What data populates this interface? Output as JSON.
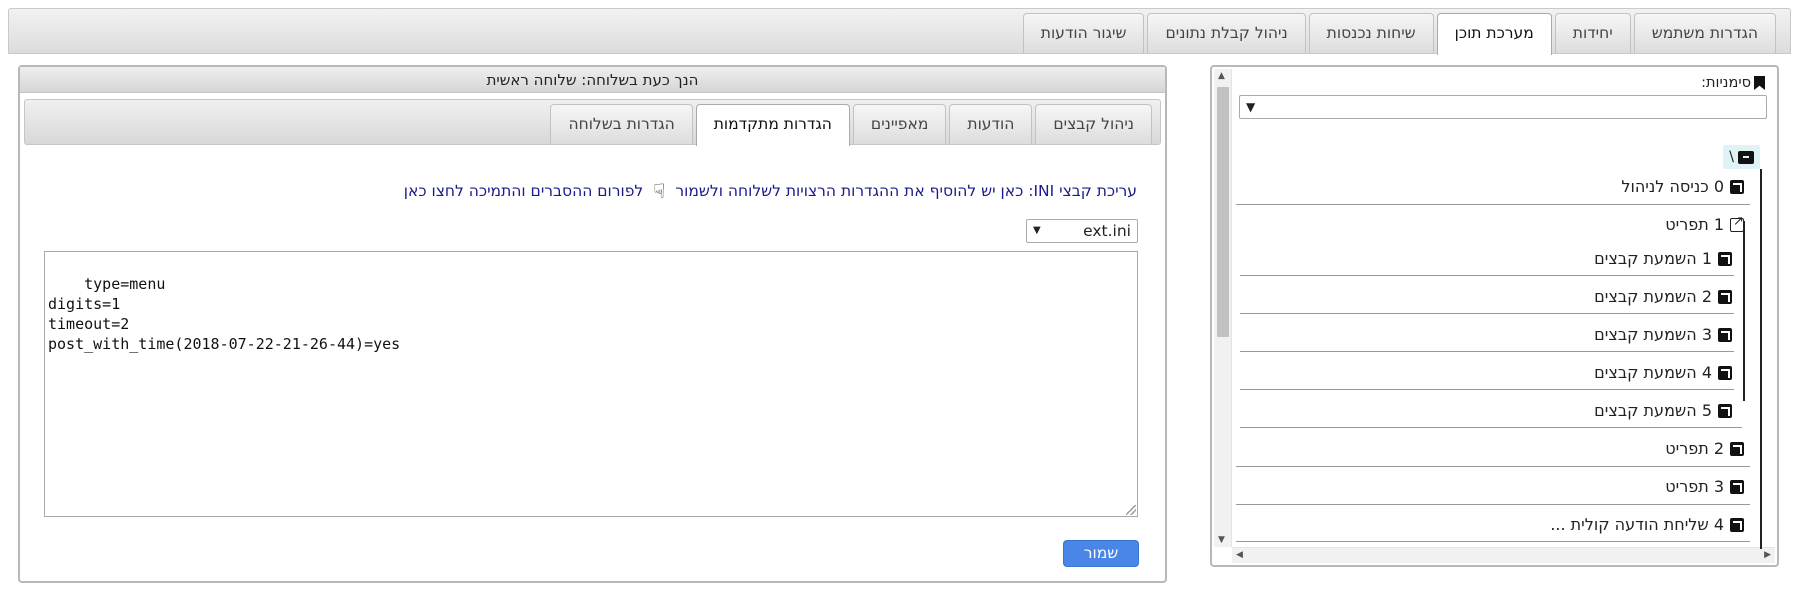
{
  "top_tabs": [
    {
      "label": "הגדרות משתמש",
      "active": false
    },
    {
      "label": "יחידות",
      "active": false
    },
    {
      "label": "מערכת תוכן",
      "active": true
    },
    {
      "label": "שיחות נכנסות",
      "active": false
    },
    {
      "label": "ניהול קבלת נתונים",
      "active": false
    },
    {
      "label": "שיגור הודעות",
      "active": false
    }
  ],
  "bookmarks": {
    "label": "סימניות:",
    "select_value": "",
    "root_label": "\\",
    "items": [
      {
        "label": "0 כניסה לניהול"
      },
      {
        "label": "1 תפריט"
      },
      {
        "label": "1 השמעת קבצים"
      },
      {
        "label": "2 השמעת קבצים"
      },
      {
        "label": "3 השמעת קבצים"
      },
      {
        "label": "4 השמעת קבצים"
      },
      {
        "label": "5 השמעת קבצים"
      },
      {
        "label": "2 תפריט"
      },
      {
        "label": "3 תפריט"
      },
      {
        "label": "4 שליחת הודעה קולית ..."
      }
    ]
  },
  "main": {
    "header": "הנך כעת בשלוחה: שלוחה ראשית",
    "sub_tabs": [
      {
        "label": "ניהול קבצים",
        "active": false
      },
      {
        "label": "הודעות",
        "active": false
      },
      {
        "label": "מאפיינים",
        "active": false
      },
      {
        "label": "הגדרות מתקדמות",
        "active": true
      },
      {
        "label": "הגדרות בשלוחה",
        "active": false
      }
    ],
    "info_text": "עריכת קבצי INI: כאן יש להוסיף את ההגדרות הרצויות לשלוחה ולשמור",
    "info_link": "לפורום ההסברים והתמיכה לחצו כאן",
    "file_select": "ext.ini",
    "editor_text": "type=menu\ndigits=1\ntimeout=2\npost_with_time(2018-07-22-21-26-44)=yes",
    "save_label": "שמור"
  },
  "colors": {
    "accent": "#4a86e8",
    "link": "#1a1a8a",
    "root_highlight": "#dff3f6"
  },
  "icons": {
    "bookmark": "bookmark-icon",
    "archive": "archive-icon",
    "node": "arrow-square-icon",
    "external": "external-link-icon",
    "hand": "pointing-hand-icon"
  }
}
